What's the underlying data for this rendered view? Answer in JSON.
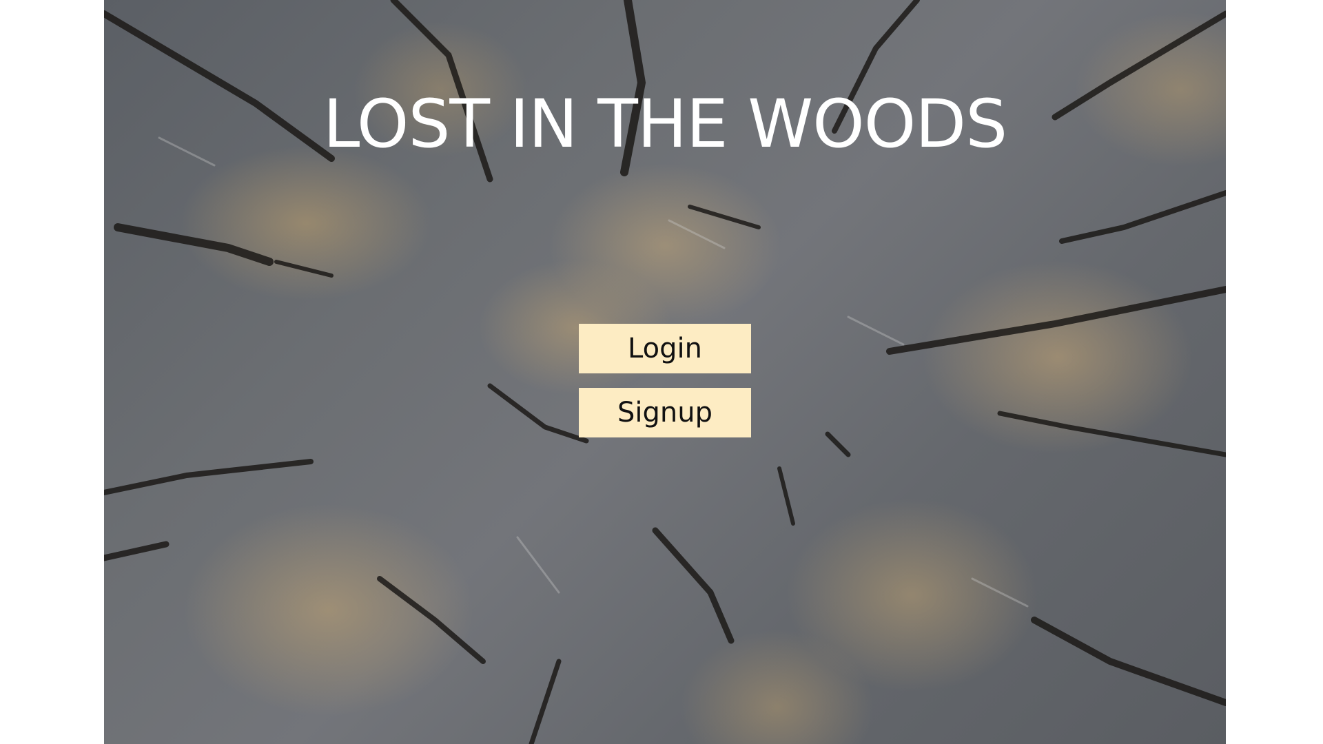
{
  "app": {
    "title": "LOST IN THE WOODS"
  },
  "buttons": {
    "login_label": "Login",
    "signup_label": "Signup"
  },
  "colors": {
    "button_background": "#fdecc3",
    "title_text": "#ffffff",
    "button_text": "#111111"
  }
}
